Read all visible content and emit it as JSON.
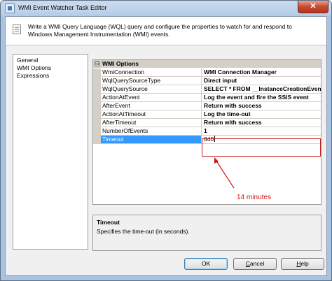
{
  "window": {
    "title": "WMI Event Watcher Task Editor",
    "close_glyph": "✕",
    "app_icon": "task-editor-icon"
  },
  "header": {
    "description": "Write a WMI Query Language (WQL) query and configure the properties to watch for and respond to Windows Management Instrumentation (WMI) events.",
    "icon": "document-icon"
  },
  "nav": {
    "items": [
      {
        "label": "General"
      },
      {
        "label": "WMI Options"
      },
      {
        "label": "Expressions"
      }
    ]
  },
  "grid": {
    "category": {
      "label": "WMI Options",
      "toggle": "⊟"
    },
    "rows": [
      {
        "name": "WmiConnection",
        "value": "WMI Connection Manager"
      },
      {
        "name": "WqlQuerySourceType",
        "value": "Direct input"
      },
      {
        "name": "WqlQuerySource",
        "value": "SELECT * FROM __InstanceCreationEvent WITHIN"
      },
      {
        "name": "ActionAtEvent",
        "value": "Log the event and fire the SSIS event"
      },
      {
        "name": "AfterEvent",
        "value": "Return with success"
      },
      {
        "name": "ActionAtTimeout",
        "value": "Log the time-out"
      },
      {
        "name": "AfterTimeout",
        "value": "Return with success"
      },
      {
        "name": "NumberOfEvents",
        "value": "1"
      },
      {
        "name": "Timeout",
        "value": "840"
      }
    ],
    "selected_row": "Timeout"
  },
  "annotation": {
    "text": "14 minutes",
    "color": "#d01414"
  },
  "description_panel": {
    "title": "Timeout",
    "text": "Specifies the time-out (in seconds)."
  },
  "footer": {
    "ok_label": "OK",
    "cancel_prefix": "",
    "cancel_mnemonic": "C",
    "cancel_rest": "ancel",
    "help_prefix": "",
    "help_mnemonic": "H",
    "help_rest": "elp"
  },
  "colors": {
    "selection": "#3399ff",
    "highlight_box": "#c71b1b",
    "grid_lines": "#d4d0c8"
  }
}
